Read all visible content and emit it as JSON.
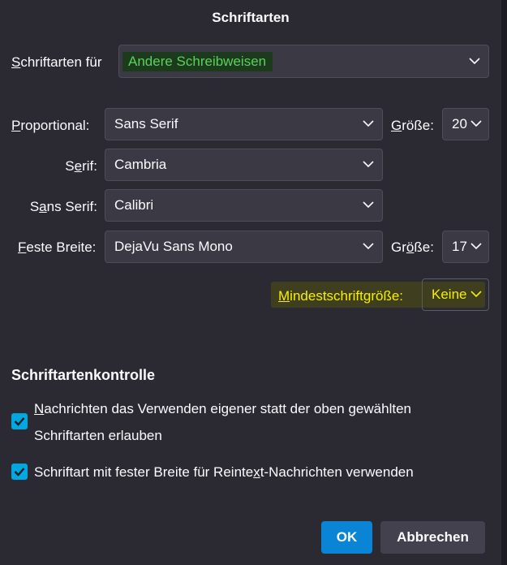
{
  "dialog": {
    "title": "Schriftarten"
  },
  "fonts_for": {
    "label_first": "S",
    "label_rest": "chriftarten für",
    "value": "Andere Schreibweisen"
  },
  "proportional": {
    "label_first": "P",
    "label_rest": "roportional:",
    "value": "Sans Serif",
    "size_label_first": "G",
    "size_label_rest": "röße:",
    "size_value": "20"
  },
  "serif": {
    "label_pre": "S",
    "label_u": "e",
    "label_post": "rif:",
    "value": "Cambria"
  },
  "sans_serif": {
    "label_pre": "S",
    "label_u": "a",
    "label_post": "ns Serif:",
    "value": "Calibri"
  },
  "monospace": {
    "label_first": "F",
    "label_rest": "este Breite:",
    "value": "DejaVu Sans Mono",
    "size_label_pre": "Gr",
    "size_label_u": "ö",
    "size_label_post": "ße:",
    "size_value": "17"
  },
  "min_size": {
    "label_first": "M",
    "label_rest": "indestschriftgröße:",
    "value": "Keine"
  },
  "font_control": {
    "title": "Schriftartenkontrolle",
    "option1_first": "N",
    "option1_line1_rest": "achrichten das Verwenden eigener statt der oben gewählten",
    "option1_line2": "Schriftarten erlauben",
    "option2_pre": "Schriftart mit fester Breite für Reinte",
    "option2_u": "x",
    "option2_post": "t-Nachrichten verwenden"
  },
  "buttons": {
    "ok": "OK",
    "cancel": "Abbrechen"
  },
  "colors": {
    "background": "#2b2a33",
    "accent": "#0a84d4",
    "checkbox": "#00a7e0",
    "highlight_green": "#5bd05b",
    "highlight_yellow": "#f4f000"
  }
}
